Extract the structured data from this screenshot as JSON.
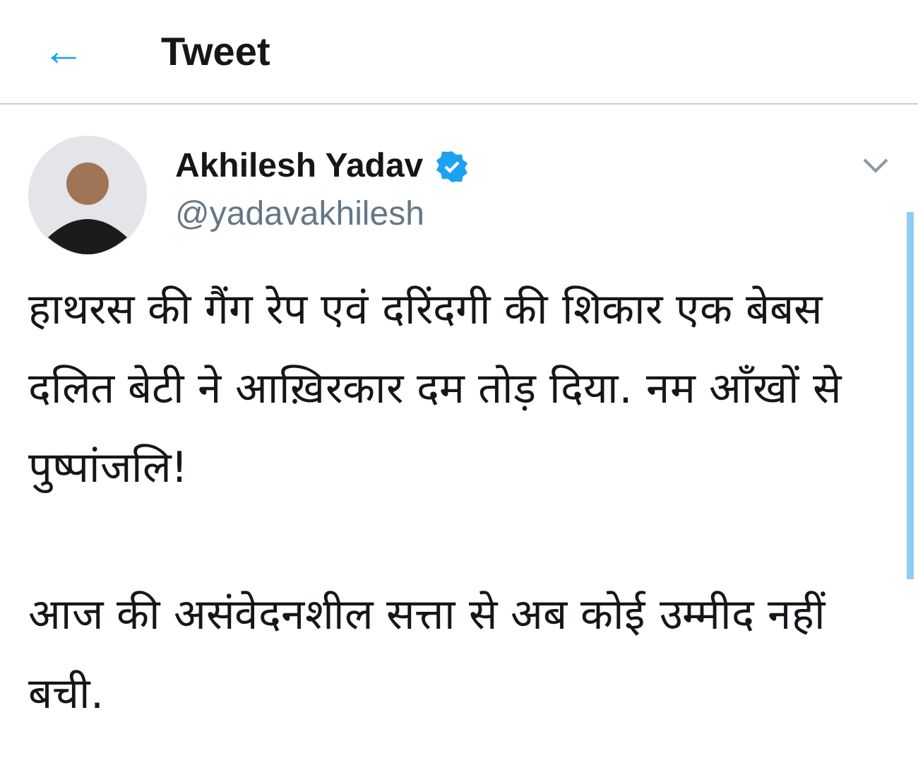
{
  "header": {
    "back": "←",
    "title": "Tweet"
  },
  "tweet": {
    "author": "Akhilesh Yadav",
    "verified": true,
    "handle": "@yadavakhilesh",
    "paragraphs": [
      "हाथरस की गैंग रेप एवं दरिंदगी की शिकार एक बेबस दलित बेटी ने आख़िरकार दम तोड़ दिया. नम आँखों से पुष्पांजलि!",
      "आज की असंवेदनशील सत्ता से अब कोई उम्मीद नहीं बची."
    ]
  }
}
